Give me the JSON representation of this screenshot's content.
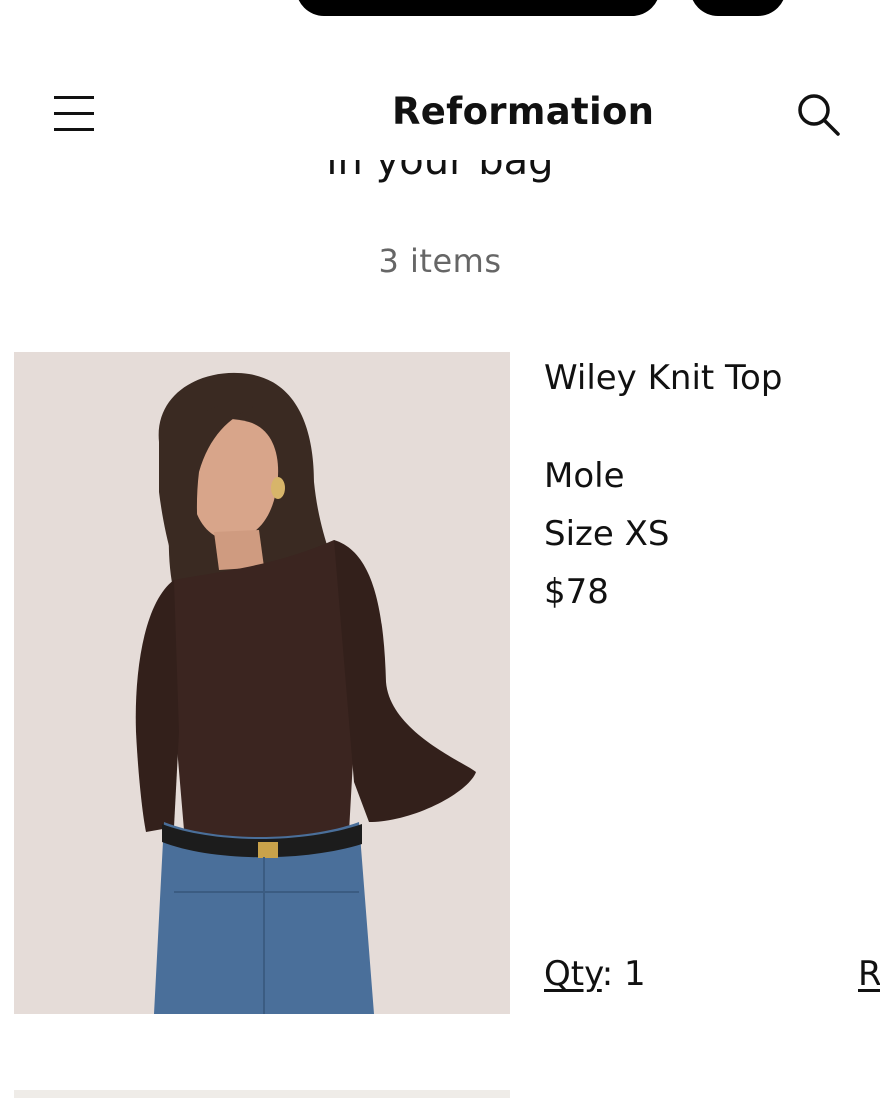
{
  "header": {
    "brand": "Reformation"
  },
  "bag": {
    "heading": "in your bag",
    "items_count": "3 items"
  },
  "product": {
    "name": "Wiley Knit Top",
    "color": "Mole",
    "size": "Size XS",
    "price": "$78",
    "qty_label": "Qty",
    "qty_value": ": 1",
    "remove_label": "R"
  },
  "colors": {
    "text": "#111111",
    "muted": "#666666",
    "image_background": "#e5dcd8",
    "top_color": "#3b2520",
    "denim": "#4a6f9a"
  }
}
